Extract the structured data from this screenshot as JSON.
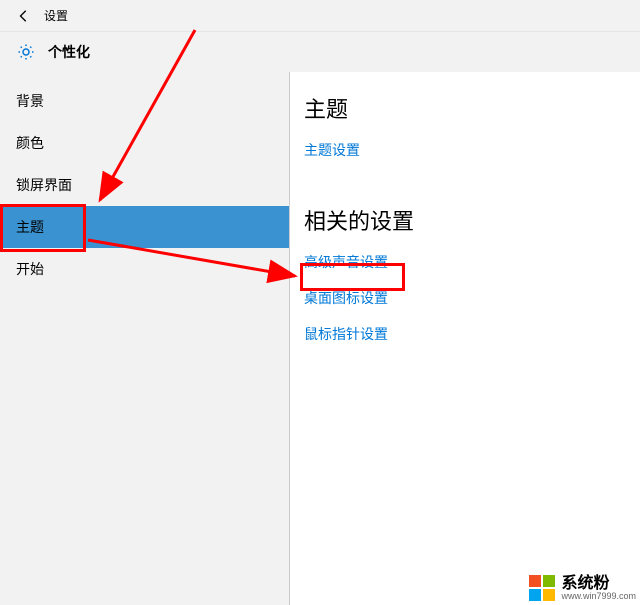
{
  "titlebar": {
    "title": "设置"
  },
  "header": {
    "page_title": "个性化"
  },
  "sidebar": {
    "items": [
      {
        "label": "背景",
        "selected": false
      },
      {
        "label": "颜色",
        "selected": false
      },
      {
        "label": "锁屏界面",
        "selected": false
      },
      {
        "label": "主题",
        "selected": true
      },
      {
        "label": "开始",
        "selected": false
      }
    ]
  },
  "main": {
    "section1_heading": "主题",
    "link1": "主题设置",
    "section2_heading": "相关的设置",
    "link2": "高级声音设置",
    "link3": "桌面图标设置",
    "link4": "鼠标指针设置"
  },
  "watermark": {
    "brand": "系统粉",
    "url": "www.win7999.com"
  }
}
